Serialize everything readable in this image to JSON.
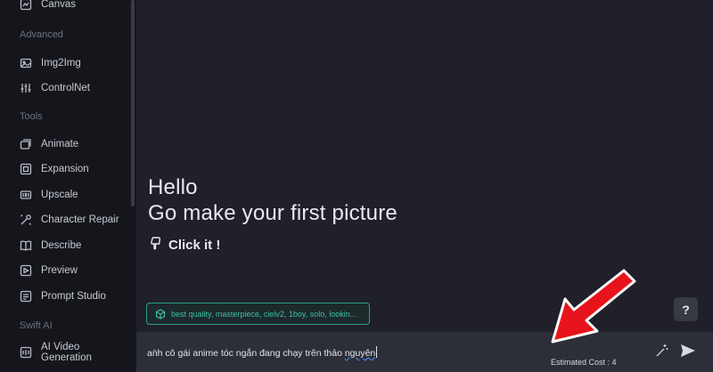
{
  "sidebar": {
    "top_item": {
      "label": "Canvas",
      "icon": "canvas-icon"
    },
    "sections": [
      {
        "title": "Advanced",
        "items": [
          {
            "label": "Img2Img",
            "icon": "image-icon"
          },
          {
            "label": "ControlNet",
            "icon": "sliders-icon"
          }
        ]
      },
      {
        "title": "Tools",
        "items": [
          {
            "label": "Animate",
            "icon": "animate-icon"
          },
          {
            "label": "Expansion",
            "icon": "expand-icon"
          },
          {
            "label": "Upscale",
            "icon": "upscale-icon"
          },
          {
            "label": "Character Repair",
            "icon": "repair-icon"
          },
          {
            "label": "Describe",
            "icon": "book-icon"
          },
          {
            "label": "Preview",
            "icon": "preview-icon"
          },
          {
            "label": "Prompt Studio",
            "icon": "studio-icon"
          }
        ]
      },
      {
        "title": "Swift AI",
        "items": [
          {
            "label": "AI Video Generation",
            "icon": "video-icon"
          }
        ]
      }
    ]
  },
  "main": {
    "hello_line1": "Hello",
    "hello_line2": "Go make your first picture",
    "click_it": "Click it !",
    "suggestion": "best quality, masterpiece, cielv2, 1boy, solo, lookin...",
    "help_label": "?"
  },
  "input_bar": {
    "prompt_value_main": "aǹh cô gái anime tóc ngắn đang chạy trên thảo ",
    "prompt_value_underlined": "nguyên",
    "estimated_cost": "Estimated Cost : 4"
  },
  "annotation": {
    "arrow_color": "#e8141c"
  }
}
